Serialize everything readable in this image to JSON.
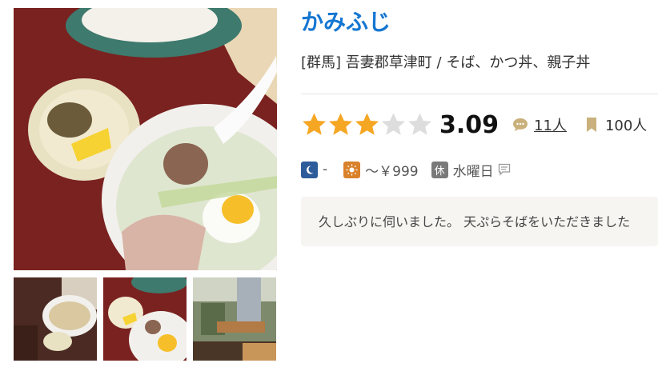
{
  "restaurant": {
    "name": "かみふじ",
    "area": "[群馬]",
    "location": "吾妻郡草津町",
    "separator": "/",
    "genres": "そば、かつ丼、親子丼"
  },
  "rating": {
    "score": "3.09",
    "stars_value": 3.09,
    "stars_max": 5,
    "reviews_count": "11人",
    "bookmarks_count": "100人"
  },
  "prices": {
    "dinner": "-",
    "lunch": "～￥999",
    "holiday": "水曜日",
    "holiday_badge": "休"
  },
  "review_snippet": "久しぶりに伺いました。 天ぷらそばをいただきました",
  "colors": {
    "title": "#1476d2",
    "star_on": "#f5a623",
    "star_off": "#dddddd",
    "dinner_badge": "#2d5c9a",
    "lunch_badge": "#d9822b"
  },
  "icons": {
    "review": "speech-bubble-icon",
    "bookmark": "bookmark-icon",
    "dinner": "moon-icon",
    "lunch": "sun-icon",
    "holiday": "holiday-icon",
    "comment": "comment-icon"
  }
}
